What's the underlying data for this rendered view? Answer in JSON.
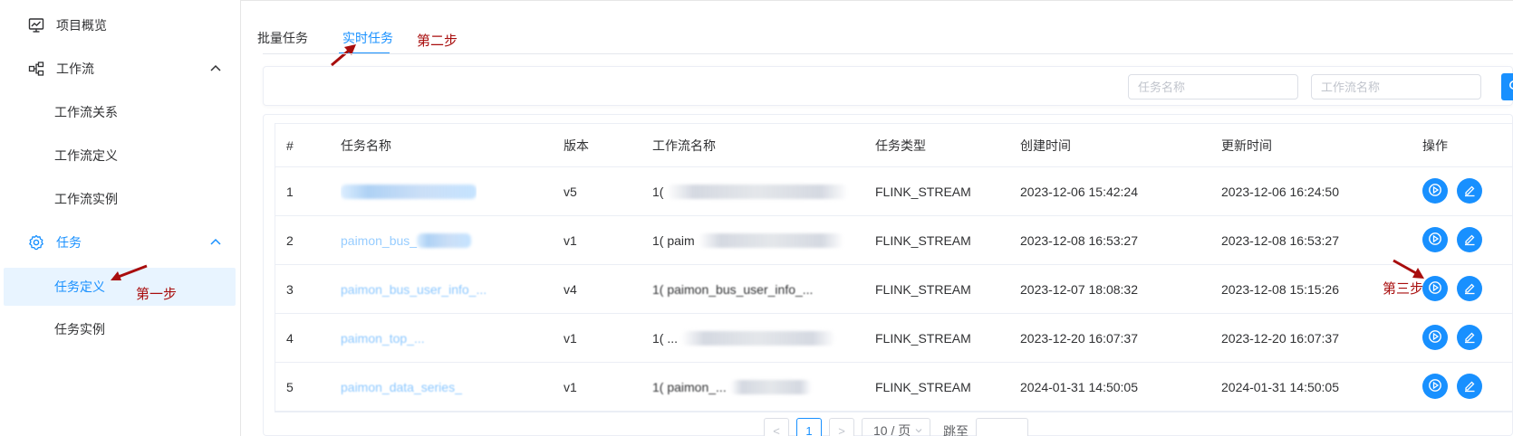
{
  "sidebar": {
    "items": [
      {
        "label": "项目概览",
        "icon": "monitor-chart-icon"
      },
      {
        "label": "工作流",
        "icon": "workflow-icon",
        "expanded": true
      },
      {
        "label": "工作流关系"
      },
      {
        "label": "工作流定义"
      },
      {
        "label": "工作流实例"
      },
      {
        "label": "任务",
        "icon": "gear-icon",
        "expanded": true,
        "active": true
      },
      {
        "label": "任务定义",
        "selected": true
      },
      {
        "label": "任务实例"
      }
    ]
  },
  "tabs": [
    {
      "label": "批量任务",
      "active": false
    },
    {
      "label": "实时任务",
      "active": true
    }
  ],
  "annotations": {
    "step1": "第一步",
    "step2": "第二步",
    "step3": "第三步"
  },
  "search": {
    "task_name_placeholder": "任务名称",
    "workflow_name_placeholder": "工作流名称"
  },
  "table": {
    "headers": [
      "#",
      "任务名称",
      "版本",
      "工作流名称",
      "任务类型",
      "创建时间",
      "更新时间",
      "操作"
    ],
    "rows": [
      {
        "index": "1",
        "task_name": "",
        "version": "v5",
        "workflow_name": "1(",
        "task_type": "FLINK_STREAM",
        "created": "2023-12-06 15:42:24",
        "updated": "2023-12-06 16:24:50"
      },
      {
        "index": "2",
        "task_name": "paimon_bus_",
        "version": "v1",
        "workflow_name": "1( paim",
        "task_type": "FLINK_STREAM",
        "created": "2023-12-08 16:53:27",
        "updated": "2023-12-08 16:53:27"
      },
      {
        "index": "3",
        "task_name": "paimon_bus_user_info_...",
        "version": "v4",
        "workflow_name": "1( paimon_bus_user_info_...",
        "task_type": "FLINK_STREAM",
        "created": "2023-12-07 18:08:32",
        "updated": "2023-12-08 15:15:26"
      },
      {
        "index": "4",
        "task_name": "paimon_top_...",
        "version": "v1",
        "workflow_name": "1( ...",
        "task_type": "FLINK_STREAM",
        "created": "2023-12-20 16:07:37",
        "updated": "2023-12-20 16:07:37"
      },
      {
        "index": "5",
        "task_name": "paimon_data_series_",
        "version": "v1",
        "workflow_name": "1( paimon_...",
        "task_type": "FLINK_STREAM",
        "created": "2024-01-31 14:50:05",
        "updated": "2024-01-31 14:50:05"
      }
    ]
  },
  "pagination": {
    "prev": "<",
    "current": "1",
    "next": ">",
    "page_size": "10 / 页",
    "jump_label": "跳至"
  },
  "colors": {
    "accent": "#1890ff",
    "annotation": "#a80d0d",
    "selected_bg": "#e8f4ff"
  }
}
